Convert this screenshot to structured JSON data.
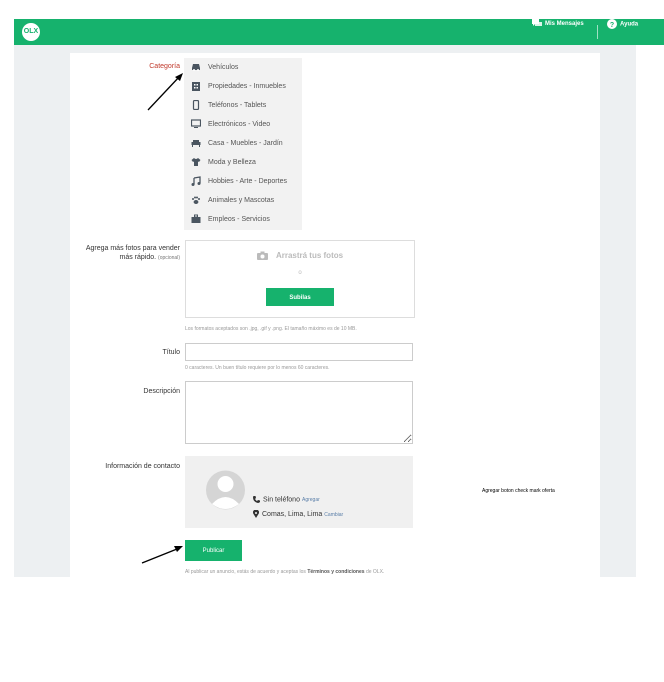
{
  "header": {
    "logo_text": "OLX",
    "messages_label": "Mis Mensajes",
    "help_label": "Ayuda"
  },
  "form": {
    "category": {
      "label": "Categoría",
      "items": [
        {
          "label": "Vehículos",
          "icon": "car-icon"
        },
        {
          "label": "Propiedades - Inmuebles",
          "icon": "building-icon"
        },
        {
          "label": "Teléfonos - Tablets",
          "icon": "phone-icon"
        },
        {
          "label": "Electrónicos - Video",
          "icon": "monitor-icon"
        },
        {
          "label": "Casa - Muebles - Jardín",
          "icon": "sofa-icon"
        },
        {
          "label": "Moda y Belleza",
          "icon": "clothes-icon"
        },
        {
          "label": "Hobbies - Arte - Deportes",
          "icon": "music-note-icon"
        },
        {
          "label": "Animales y Mascotas",
          "icon": "paw-icon"
        },
        {
          "label": "Empleos - Servicios",
          "icon": "briefcase-icon"
        }
      ]
    },
    "photos": {
      "label": "Agrega más fotos para vender",
      "label_line2": "más rápido.",
      "optional": "(opcional)",
      "drop_title": "Arrastrá tus fotos",
      "or": "o",
      "upload_button": "Subilas",
      "hint": "Los formatos aceptados son .jpg, .gif y .png. El tamaño máximo es de 10 MB."
    },
    "title": {
      "label": "Título",
      "value": "",
      "hint": "0 caracteres. Un buen título requiere por lo menos 60 caracteres."
    },
    "description": {
      "label": "Descripción",
      "value": ""
    },
    "contact": {
      "label": "Información de contacto",
      "phone": "Sin teléfono",
      "phone_action": "Agregar",
      "location": "Comas, Lima, Lima",
      "location_action": "Cambiar"
    },
    "publish_button": "Publicar",
    "terms_prefix": "Al publicar un anuncio, estás de acuerdo y aceptas los",
    "terms_link": "Términos y condiciones",
    "terms_suffix": "de OLX."
  },
  "annotation_note": "Agregar boton check mark oferta",
  "colors": {
    "brand_green": "#16b26d",
    "required_red": "#c0392b"
  }
}
